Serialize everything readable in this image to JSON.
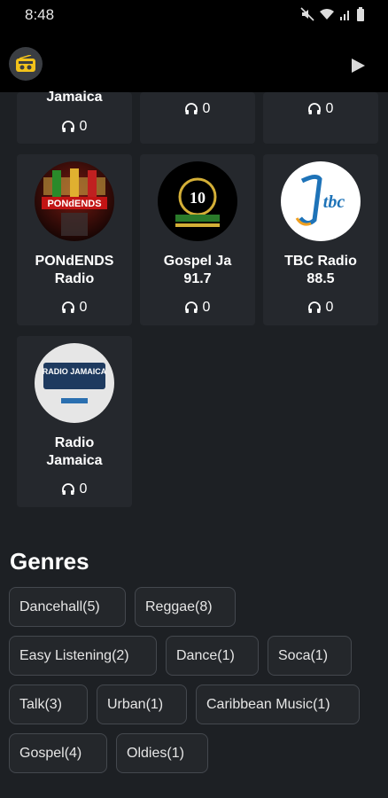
{
  "status": {
    "time": "8:48"
  },
  "stations_partial": [
    {
      "name": "Jamaica",
      "listeners": "0"
    },
    {
      "listeners": "0"
    },
    {
      "listeners": "0"
    }
  ],
  "stations": [
    {
      "name_line1": "PONdENDS",
      "name_line2": "Radio",
      "listeners": "0",
      "logo_text": "PONdENDS"
    },
    {
      "name_line1": "Gospel Ja",
      "name_line2": "91.7",
      "listeners": "0",
      "logo_text": "10"
    },
    {
      "name_line1": "TBC Radio",
      "name_line2": "88.5",
      "listeners": "0",
      "logo_text": "tbc"
    },
    {
      "name_line1": "Radio",
      "name_line2": "Jamaica",
      "listeners": "0",
      "logo_text": "RADIO JAMAICA"
    }
  ],
  "genres": {
    "title": "Genres",
    "chips": [
      {
        "label": "Dancehall",
        "count": "(5)"
      },
      {
        "label": "Reggae",
        "count": "(8)"
      },
      {
        "label": "Easy Listening",
        "count": "(2)"
      },
      {
        "label": "Dance",
        "count": "(1)"
      },
      {
        "label": "Soca",
        "count": "(1)"
      },
      {
        "label": "Talk",
        "count": "(3)"
      },
      {
        "label": "Urban",
        "count": "(1)"
      },
      {
        "label": "Caribbean Music",
        "count": "(1)"
      },
      {
        "label": "Gospel",
        "count": "(4)"
      },
      {
        "label": "Oldies",
        "count": "(1)"
      }
    ]
  },
  "colors": {
    "background": "#1d2024",
    "card": "#25282d",
    "accent": "#f2c21b"
  },
  "icons": {
    "app_logo": "radio-icon",
    "play": "play-icon",
    "listeners": "headphones-icon"
  }
}
